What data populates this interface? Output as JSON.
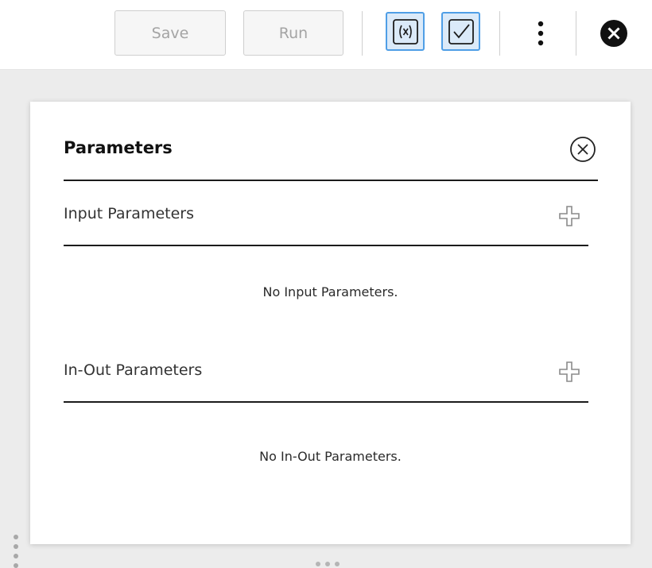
{
  "toolbar": {
    "save_label": "Save",
    "run_label": "Run",
    "variables_icon": "function-variable-icon",
    "validate_icon": "checkbox-check-icon",
    "more_icon": "vertical-ellipsis-icon",
    "close_icon": "close-circle-filled-icon",
    "accent_color": "#4f9ee6"
  },
  "panel": {
    "title": "Parameters",
    "close_icon": "close-circle-outline-icon",
    "input_section": {
      "label": "Input Parameters",
      "add_icon": "plus-icon",
      "empty_message": "No Input Parameters."
    },
    "inout_section": {
      "label": "In-Out Parameters",
      "add_icon": "plus-icon",
      "empty_message": "No In-Out Parameters."
    }
  }
}
